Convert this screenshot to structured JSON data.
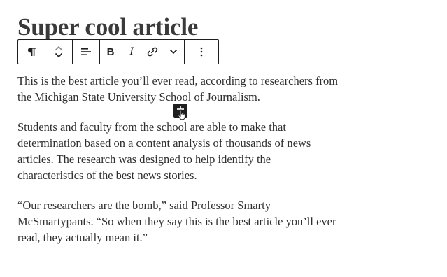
{
  "post": {
    "title": "Super cool article",
    "paragraphs": [
      "This is the best article you’ll ever read, according to researchers from the Michigan State University School of Journalism.",
      "Students and faculty from the school are able to make that determination based on a content analysis of thousands of news articles. The research was designed to help identify the characteristics of the best news stories.",
      "“Our researchers are the bomb,” said Professor Smarty McSmartypants. “So when they say this is the best article you’ll ever read, they actually mean it.”"
    ]
  },
  "toolbar": {
    "block_type_icon": "paragraph-icon",
    "move_icons": [
      "chevron-up-icon",
      "chevron-down-icon"
    ],
    "align_icon": "align-left-icon",
    "bold_label": "B",
    "italic_label": "I",
    "link_icon": "link-icon",
    "more_rich_text_icon": "chevron-down-icon",
    "options_icon": "more-vertical-icon"
  },
  "inserter": {
    "icon": "plus-icon"
  },
  "colors": {
    "text": "#2f2f2f",
    "title": "#3a3a3a",
    "toolbar_border": "#1e1e1e",
    "inserter_bg": "#1e1e1e"
  }
}
